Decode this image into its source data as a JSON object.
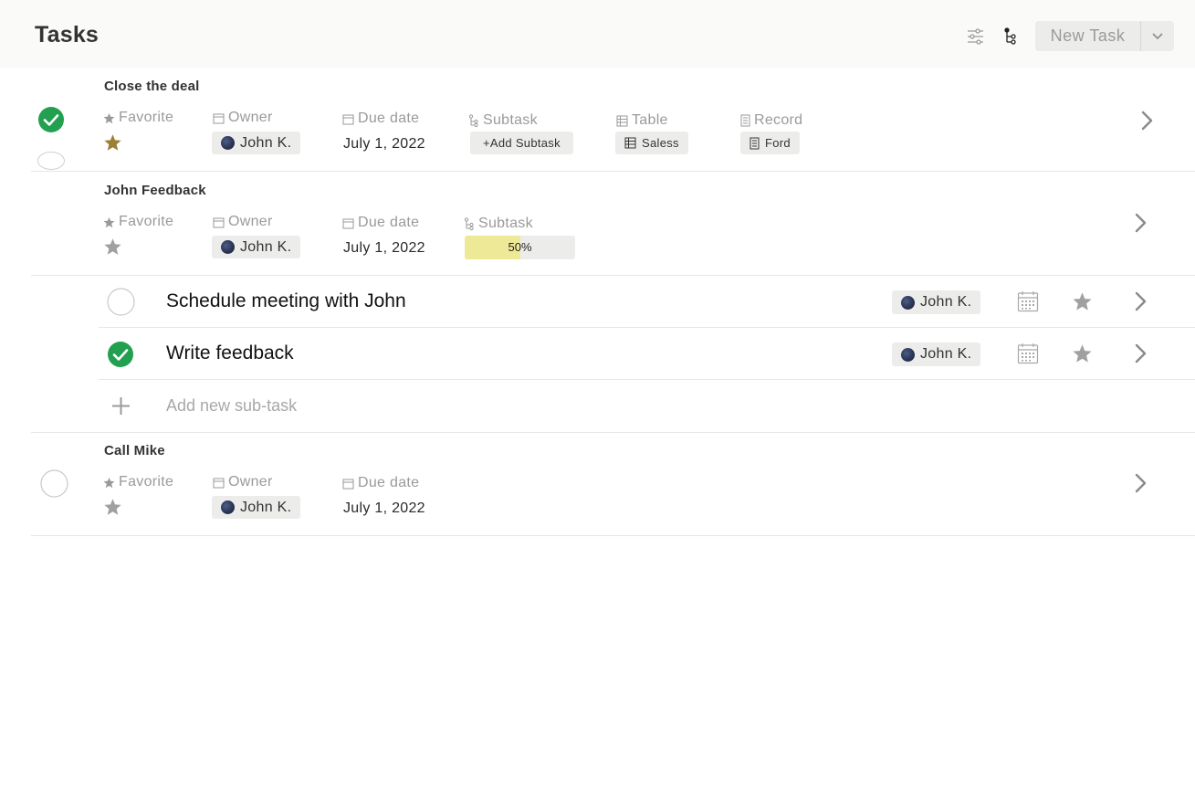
{
  "header": {
    "title": "Tasks",
    "new_task_label": "New Task"
  },
  "colors": {
    "complete": "#22a050",
    "favorite_active": "#9a8034",
    "favorite_inactive": "#a0a09e",
    "chip_bg": "#ececea",
    "progress_fill": "#eee996"
  },
  "labels": {
    "favorite": "Favorite",
    "owner": "Owner",
    "due_date": "Due date",
    "subtask": "Subtask",
    "table": "Table",
    "record": "Record"
  },
  "tasks": [
    {
      "title": "Close the deal",
      "completed": true,
      "favorite": true,
      "owner": "John K.",
      "due_date": "July 1, 2022",
      "add_subtask_label": "+Add Subtask",
      "table_value": "Saless",
      "record_value": "Ford"
    },
    {
      "title": "John Feedback",
      "favorite": false,
      "owner": "John K.",
      "due_date": "July 1, 2022",
      "subtask_progress": 50,
      "subtask_progress_text": "50%",
      "subtasks": [
        {
          "title": "Schedule meeting with John",
          "completed": false,
          "owner": "John K."
        },
        {
          "title": "Write feedback",
          "completed": true,
          "owner": "John K."
        }
      ],
      "add_subtask_placeholder": "Add new sub-task"
    },
    {
      "title": "Call Mike",
      "completed": false,
      "favorite": false,
      "owner": "John K.",
      "due_date": "July 1, 2022"
    }
  ]
}
